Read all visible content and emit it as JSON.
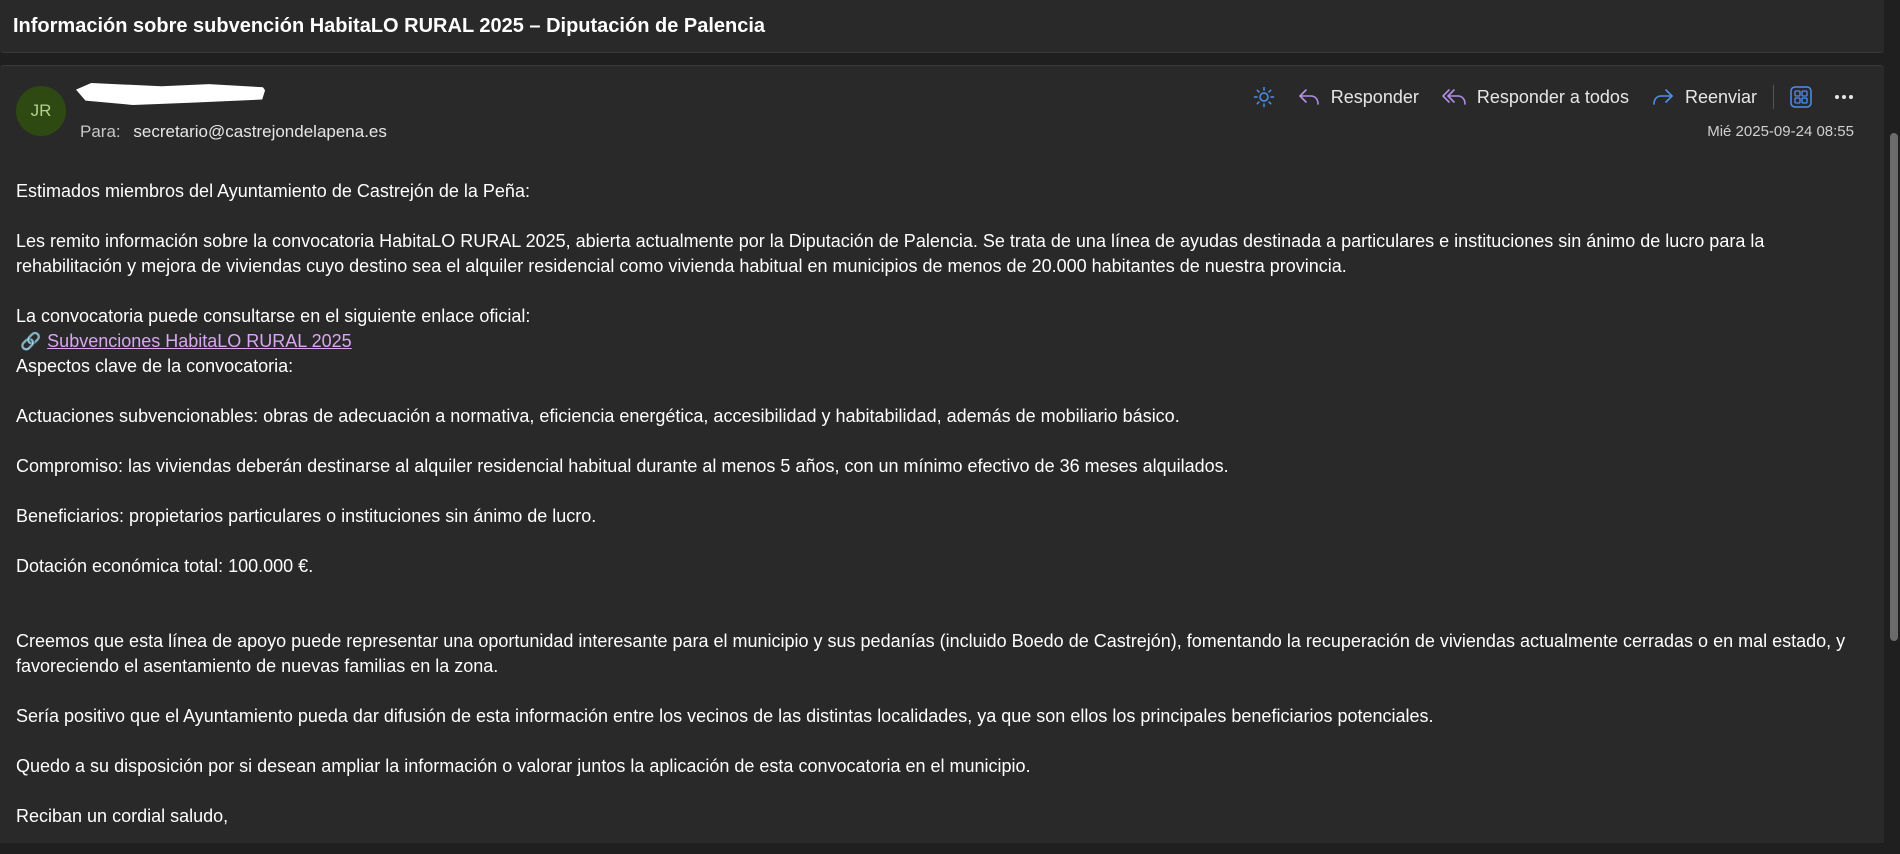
{
  "subject": "Información sobre subvención HabitaLO RURAL 2025 – Diputación de Palencia",
  "sender": {
    "initials": "JR",
    "to_label": "Para:",
    "to_address": "secretario@castrejondelapena.es",
    "date": "Mié 2025-09-24 08:55"
  },
  "actions": {
    "reply": "Responder",
    "reply_all": "Responder a todos",
    "forward": "Reenviar"
  },
  "colors": {
    "accent": "#4f8fe8",
    "link": "#d9a6f0",
    "avatar_bg": "#2e4a12"
  },
  "body": {
    "greeting": "Estimados miembros del Ayuntamiento de Castrejón de la Peña:",
    "p1": "Les remito información sobre la convocatoria HabitaLO RURAL 2025, abierta actualmente por la Diputación de Palencia. Se trata de una línea de ayudas destinada a particulares e instituciones sin ánimo de lucro para la rehabilitación y mejora de viviendas cuyo destino sea el alquiler residencial como vivienda habitual en municipios de menos de 20.000 habitantes de nuestra provincia.",
    "p2": "La convocatoria puede consultarse en el siguiente enlace oficial:",
    "link_icon": "🔗",
    "link_text": "Subvenciones HabitaLO RURAL 2025",
    "p3": "Aspectos clave de la convocatoria:",
    "p4": "Actuaciones subvencionables: obras de adecuación a normativa, eficiencia energética, accesibilidad y habitabilidad, además de mobiliario básico.",
    "p5": "Compromiso: las viviendas deberán destinarse al alquiler residencial habitual durante al menos 5 años, con un mínimo efectivo de 36 meses alquilados.",
    "p6": "Beneficiarios: propietarios particulares o instituciones sin ánimo de lucro.",
    "p7": "Dotación económica total: 100.000 €.",
    "p8": "Creemos que esta línea de apoyo puede representar una oportunidad interesante para el municipio y sus pedanías (incluido Boedo de Castrejón), fomentando la recuperación de viviendas actualmente cerradas o en mal estado, y favoreciendo el asentamiento de nuevas familias en la zona.",
    "p9": "Sería positivo que el Ayuntamiento pueda dar difusión de esta información entre los vecinos de las distintas localidades, ya que son ellos los principales beneficiarios potenciales.",
    "p10": "Quedo a su disposición por si desean ampliar la información o valorar juntos la aplicación de esta convocatoria en el municipio.",
    "closing": "Reciban un cordial saludo,"
  }
}
